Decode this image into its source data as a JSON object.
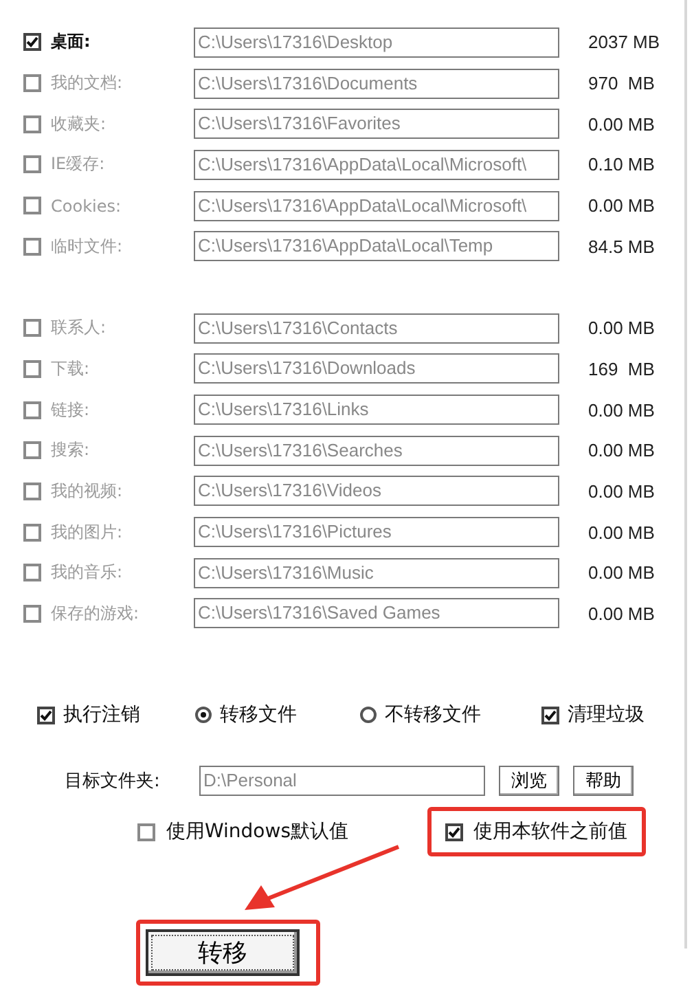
{
  "folder_groups": [
    [
      {
        "label": "桌面:",
        "path": "C:\\Users\\17316\\Desktop",
        "size": "2037 MB",
        "checked": true
      },
      {
        "label": "我的文档:",
        "path": "C:\\Users\\17316\\Documents",
        "size": "970  MB",
        "checked": false
      },
      {
        "label": "收藏夹:",
        "path": "C:\\Users\\17316\\Favorites",
        "size": "0.00 MB",
        "checked": false
      },
      {
        "label": "IE缓存:",
        "path": "C:\\Users\\17316\\AppData\\Local\\Microsoft\\",
        "size": "0.10 MB",
        "checked": false
      },
      {
        "label": "Cookies:",
        "path": "C:\\Users\\17316\\AppData\\Local\\Microsoft\\",
        "size": "0.00 MB",
        "checked": false
      },
      {
        "label": "临时文件:",
        "path": "C:\\Users\\17316\\AppData\\Local\\Temp",
        "size": "84.5 MB",
        "checked": false
      }
    ],
    [
      {
        "label": "联系人:",
        "path": "C:\\Users\\17316\\Contacts",
        "size": "0.00 MB",
        "checked": false
      },
      {
        "label": "下载:",
        "path": "C:\\Users\\17316\\Downloads",
        "size": "169  MB",
        "checked": false
      },
      {
        "label": "链接:",
        "path": "C:\\Users\\17316\\Links",
        "size": "0.00 MB",
        "checked": false
      },
      {
        "label": "搜索:",
        "path": "C:\\Users\\17316\\Searches",
        "size": "0.00 MB",
        "checked": false
      },
      {
        "label": "我的视频:",
        "path": "C:\\Users\\17316\\Videos",
        "size": "0.00 MB",
        "checked": false
      },
      {
        "label": "我的图片:",
        "path": "C:\\Users\\17316\\Pictures",
        "size": "0.00 MB",
        "checked": false
      },
      {
        "label": "我的音乐:",
        "path": "C:\\Users\\17316\\Music",
        "size": "0.00 MB",
        "checked": false
      },
      {
        "label": "保存的游戏:",
        "path": "C:\\Users\\17316\\Saved Games",
        "size": "0.00 MB",
        "checked": false
      }
    ]
  ],
  "options": [
    {
      "kind": "checkbox",
      "label": "执行注销",
      "checked": true
    },
    {
      "kind": "radio",
      "label": "转移文件",
      "selected": true
    },
    {
      "kind": "radio",
      "label": "不转移文件",
      "selected": false
    },
    {
      "kind": "checkbox",
      "label": "清理垃圾",
      "checked": true
    }
  ],
  "target": {
    "label": "目标文件夹:",
    "value": "D:\\Personal",
    "buttons": [
      "浏览",
      "帮助"
    ]
  },
  "defaults": [
    {
      "label": "使用Windows默认值",
      "checked": false,
      "highlighted": false
    },
    {
      "label": "使用本软件之前值",
      "checked": true,
      "highlighted": true
    }
  ],
  "transfer_button": {
    "label": "转移",
    "highlighted": true
  }
}
